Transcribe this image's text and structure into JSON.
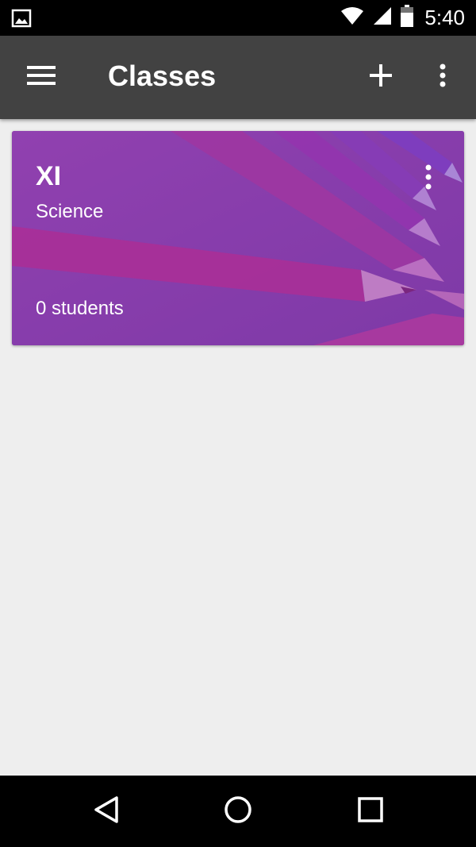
{
  "status_bar": {
    "time": "5:40",
    "icons": [
      "image-notification-icon",
      "wifi-icon",
      "cell-signal-icon",
      "battery-icon"
    ]
  },
  "app_bar": {
    "title": "Classes",
    "icons": [
      "menu-icon",
      "add-icon",
      "more-vert-icon"
    ]
  },
  "classes": [
    {
      "name": "XI",
      "section": "Science",
      "students": "0 students",
      "theme_color": "#8e44ad"
    }
  ],
  "nav_bar": {
    "icons": [
      "back-icon",
      "home-icon",
      "recents-icon"
    ]
  },
  "colors": {
    "status_bar": "#000000",
    "app_bar": "#424242",
    "background": "#eeeeee",
    "card_purple": "#8e44ad",
    "pencil_pink": "#c2268f"
  }
}
